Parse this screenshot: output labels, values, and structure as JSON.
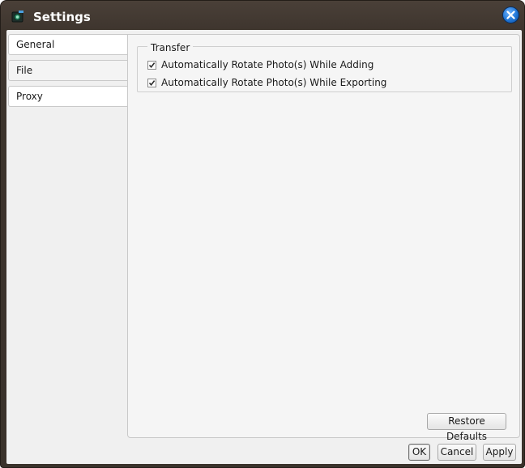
{
  "window": {
    "title": "Settings",
    "icons": {
      "app": "camera-icon",
      "close": "close-icon"
    }
  },
  "sidebar": {
    "tabs": [
      {
        "label": "General",
        "selected": true
      },
      {
        "label": "File",
        "selected": false
      },
      {
        "label": "Proxy",
        "selected": false
      }
    ]
  },
  "transfer": {
    "group_label": "Transfer",
    "options": [
      {
        "label": "Automatically Rotate Photo(s) While Adding",
        "checked": true
      },
      {
        "label": "Automatically Rotate Photo(s) While Exporting",
        "checked": true
      }
    ]
  },
  "panel": {
    "restore_defaults_label": "Restore Defaults"
  },
  "footer": {
    "ok_label": "OK",
    "cancel_label": "Cancel",
    "apply_label": "Apply"
  },
  "colors": {
    "titlebar": "#3d342d",
    "close_button": "#2076d6",
    "client": "#f0f0f0"
  }
}
